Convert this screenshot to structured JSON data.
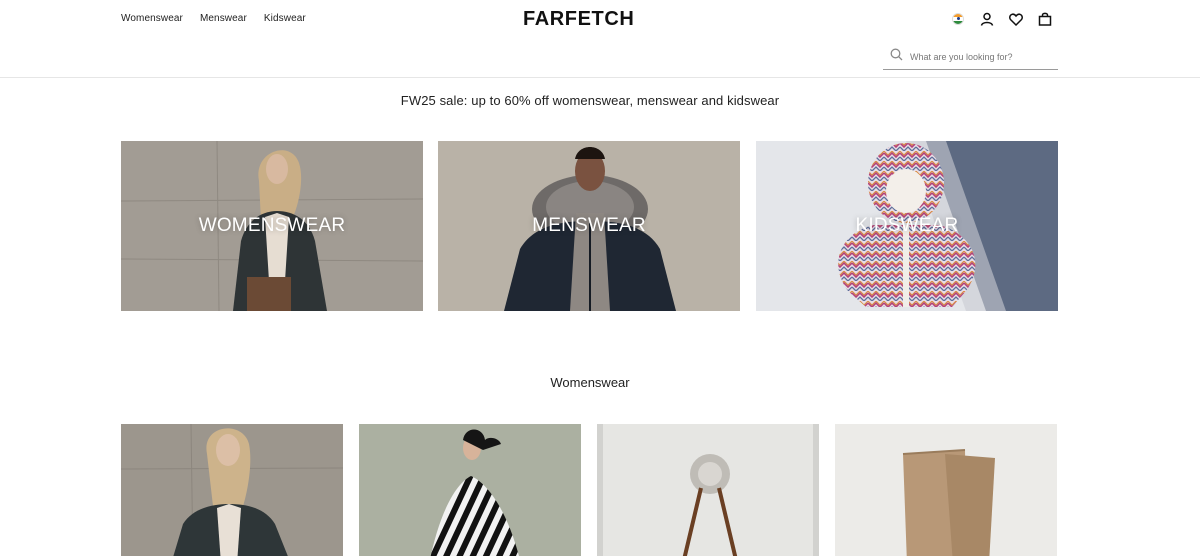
{
  "header": {
    "nav": [
      "Womenswear",
      "Menswear",
      "Kidswear"
    ],
    "logo": "FARFETCH",
    "icons": [
      "india-flag-icon",
      "account-icon",
      "wishlist-heart-icon",
      "shopping-bag-icon"
    ],
    "search": {
      "placeholder": "What are you looking for?"
    }
  },
  "promo": "FW25 sale: up to 60% off womenswear, menswear and kidswear",
  "categories": [
    {
      "label": "WOMENSWEAR"
    },
    {
      "label": "MENSWEAR"
    },
    {
      "label": "KIDSWEAR"
    }
  ],
  "section": {
    "title": "Womenswear"
  },
  "colors": {
    "text": "#222222",
    "divider": "#e6e6e6",
    "search_underline": "#9a9a9a"
  }
}
